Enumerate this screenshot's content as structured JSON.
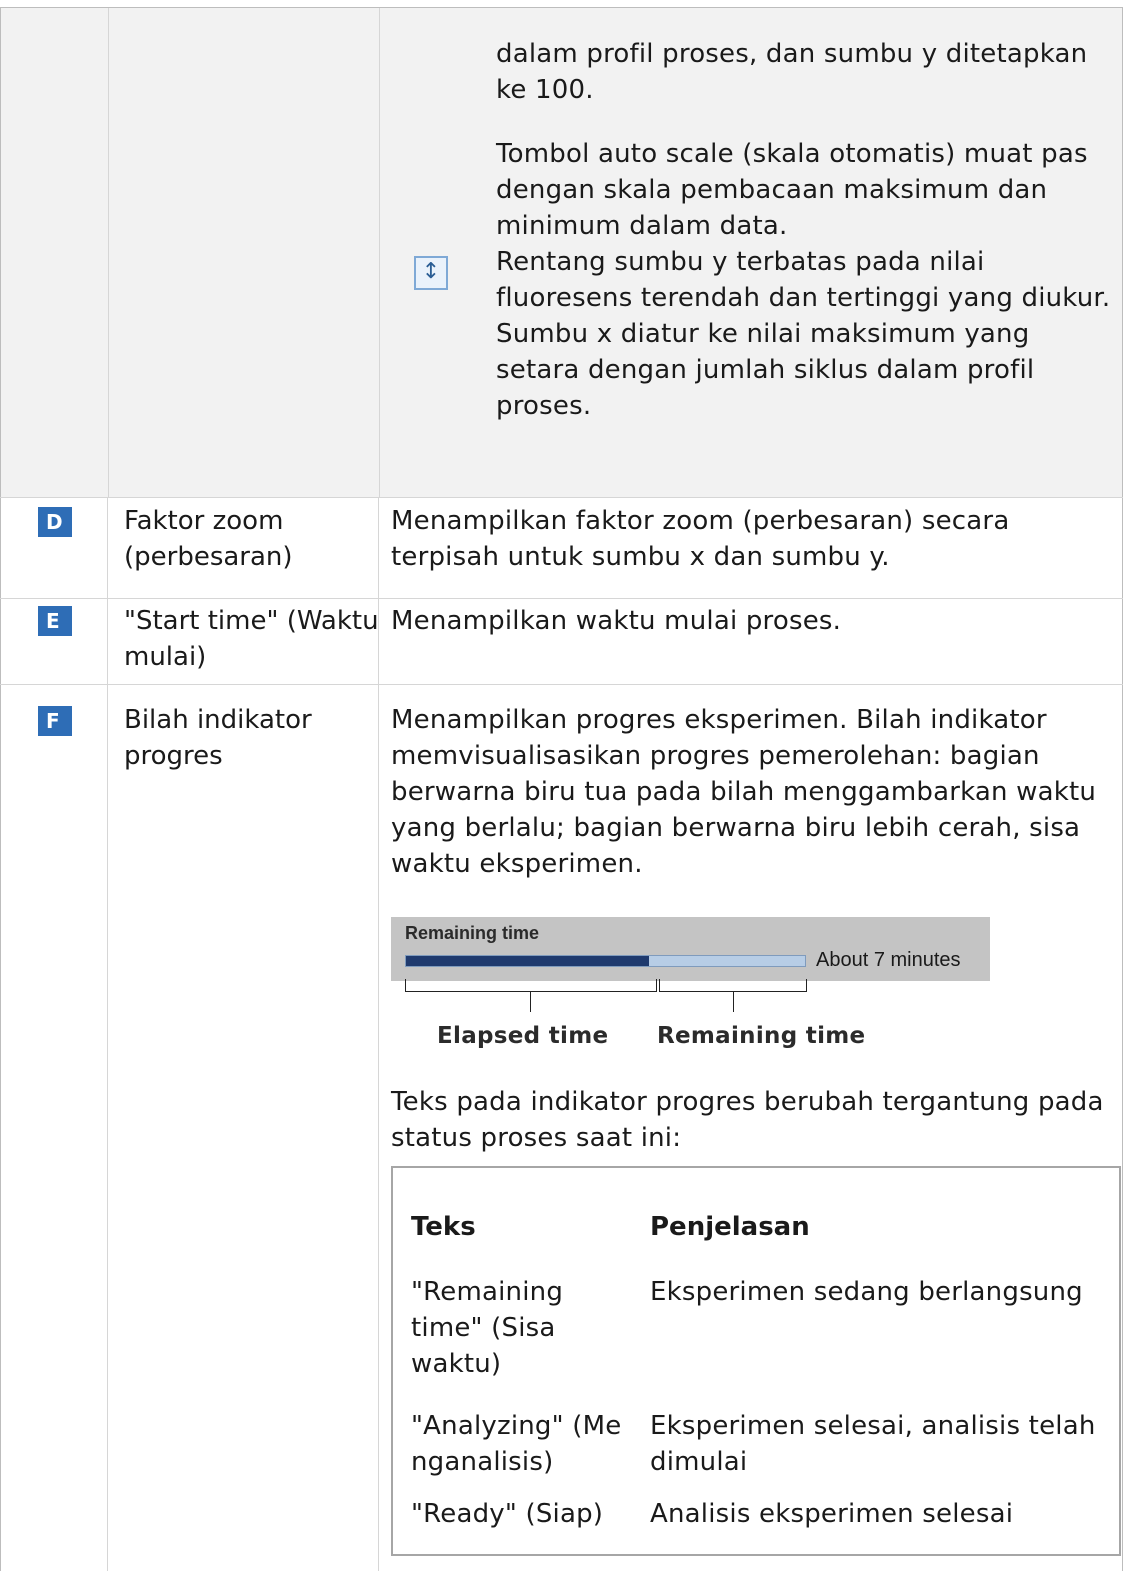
{
  "row_continuation": {
    "paragraph_1": [
      "dalam profil proses, dan sumbu y ditetapkan",
      "ke 100."
    ],
    "paragraph_2": [
      "Tombol auto scale (skala otomatis) muat pas",
      "dengan skala pembacaan maksimum dan",
      "minimum dalam data.",
      "Rentang sumbu y terbatas pada nilai",
      "fluoresens terendah dan tertinggi yang diukur.",
      "Sumbu x diatur ke nilai maksimum yang",
      "setara dengan jumlah siklus dalam profil",
      "proses."
    ],
    "icon": "auto-scale-icon"
  },
  "rows": [
    {
      "badge": "D",
      "label": [
        "Faktor zoom",
        "(perbesaran)"
      ],
      "description": [
        "Menampilkan faktor zoom (perbesaran) secara",
        "terpisah untuk sumbu x dan sumbu y."
      ]
    },
    {
      "badge": "E",
      "label": [
        "\"Start time\" (Waktu",
        "mulai)"
      ],
      "description": [
        "Menampilkan waktu mulai proses."
      ]
    },
    {
      "badge": "F",
      "label": [
        "Bilah indikator",
        "progres"
      ],
      "description": [
        "Menampilkan progres eksperimen. Bilah indikator",
        "memvisualisasikan progres pemerolehan: bagian",
        "berwarna biru tua pada bilah menggambarkan waktu",
        "yang berlalu; bagian berwarna biru lebih cerah, sisa",
        "waktu eksperimen."
      ]
    }
  ],
  "progress_figure": {
    "title": "Remaining time",
    "status": "About 7 minutes",
    "elapsed_fraction": 0.61,
    "elapsed_label": "Elapsed time",
    "remaining_label": "Remaining time",
    "colors": {
      "elapsed": "#1f3a6e",
      "remaining": "#b7cde6",
      "panel": "#c4c4c4"
    }
  },
  "after_figure": [
    "Teks pada indikator progres berubah tergantung pada",
    "status proses saat ini:"
  ],
  "status_table": {
    "headers": [
      "Teks",
      "Penjelasan"
    ],
    "rows": [
      {
        "text": [
          "\"Remaining",
          "time\" (Sisa",
          "waktu)"
        ],
        "explanation": [
          "Eksperimen sedang berlangsung"
        ]
      },
      {
        "text": [
          "\"Analyzing\" (Me",
          "nganalisis)"
        ],
        "explanation": [
          "Eksperimen selesai, analisis telah",
          "dimulai"
        ]
      },
      {
        "text": [
          "\"Ready\" (Siap)"
        ],
        "explanation": [
          "Analisis eksperimen selesai"
        ]
      }
    ]
  },
  "colors": {
    "badge": "#2e6db6",
    "grey_row": "#f2f2f2",
    "border": "#bdbdbd"
  }
}
